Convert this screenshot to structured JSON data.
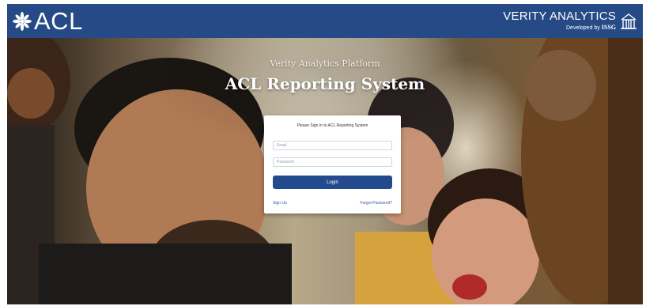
{
  "header": {
    "logo_text": "ACL",
    "product_name": "VERITY ANALYTICS",
    "developed_by_label": "Developed by",
    "developer_name": "ISSG"
  },
  "hero": {
    "subtitle": "Verity Analytics Platform",
    "title": "ACL Reporting System"
  },
  "login": {
    "heading": "Please Sign In to ACL Reporting System",
    "email_placeholder": "Email",
    "password_placeholder": "Password",
    "login_button": "Login",
    "signup_link": "Sign Up",
    "forgot_link": "Forgot Password?"
  },
  "colors": {
    "header_bg": "#254a86",
    "button_bg": "#234a8c",
    "link": "#2d5ba3"
  },
  "icons": {
    "logo": "asterisk-star-icon",
    "verity_logo": "building-icon"
  }
}
